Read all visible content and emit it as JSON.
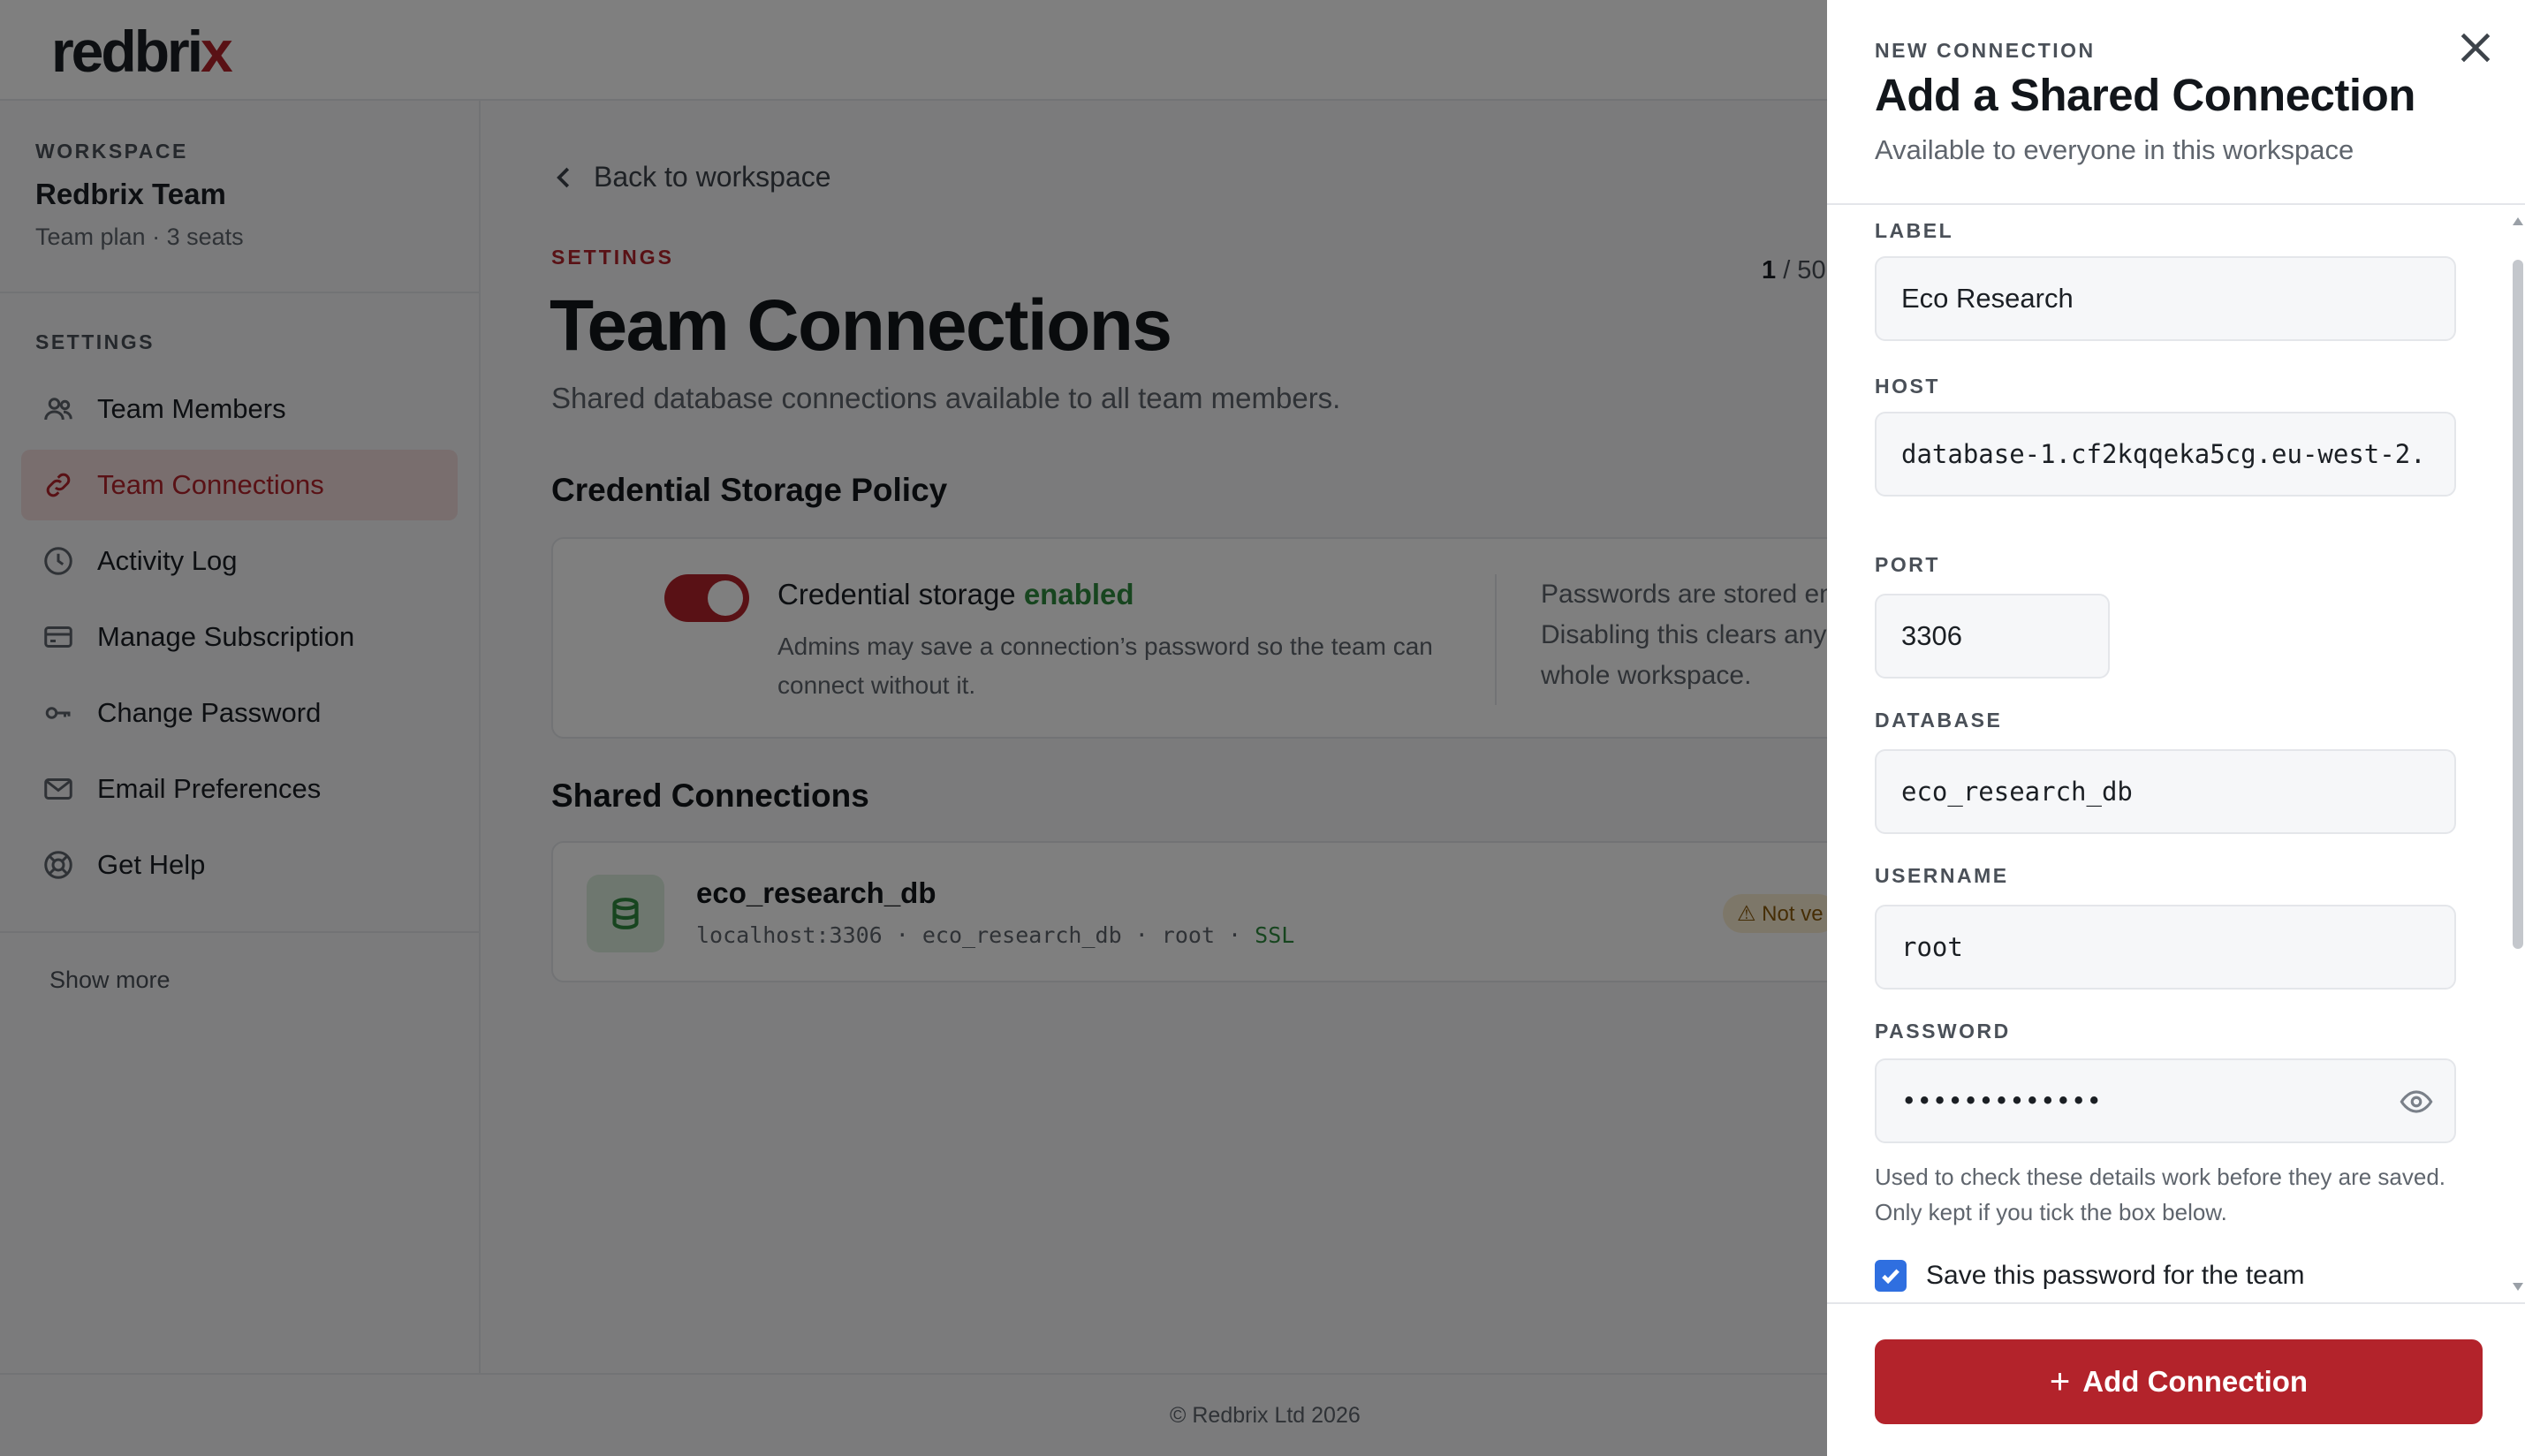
{
  "app": {
    "logo_main": "redbri",
    "logo_accent": "x"
  },
  "sidebar": {
    "workspace_eyebrow": "WORKSPACE",
    "workspace_name": "Redbrix Team",
    "workspace_plan": "Team plan · 3 seats",
    "settings_eyebrow": "SETTINGS",
    "items": [
      {
        "label": "Team Members",
        "icon": "users-icon"
      },
      {
        "label": "Team Connections",
        "icon": "link-icon",
        "active": true
      },
      {
        "label": "Activity Log",
        "icon": "clock-icon"
      },
      {
        "label": "Manage Subscription",
        "icon": "credit-card-icon"
      },
      {
        "label": "Change Password",
        "icon": "key-icon"
      },
      {
        "label": "Email Preferences",
        "icon": "mail-icon"
      },
      {
        "label": "Get Help",
        "icon": "lifebuoy-icon"
      }
    ],
    "show_more": "Show more"
  },
  "main": {
    "back_label": "Back to workspace",
    "settings_label": "SETTINGS",
    "counter_current": "1",
    "counter_rest": " / 50",
    "title": "Team Connections",
    "subtitle": "Shared database connections available to all team members.",
    "policy_title": "Credential Storage Policy",
    "policy": {
      "toggle_on": true,
      "status_prefix": "Credential storage ",
      "status_value": "enabled",
      "description": "Admins may save a connection’s password so the team can connect without it.",
      "note": "Passwords are stored en Disabling this clears any whole workspace.",
      "note_lines": [
        "Passwords are stored en",
        "Disabling this clears any",
        "whole workspace."
      ]
    },
    "connections_title": "Shared Connections",
    "connections": [
      {
        "name": "eco_research_db",
        "meta": "localhost:3306 · eco_research_db · root · ",
        "ssl": "SSL",
        "badge": "⚠ Not ve",
        "icon": "database-icon"
      }
    ]
  },
  "footer": {
    "copyright": "© Redbrix Ltd 2026"
  },
  "drawer": {
    "eyebrow": "NEW CONNECTION",
    "title": "Add a Shared Connection",
    "subtitle": "Available to everyone in this workspace",
    "fields": {
      "label": {
        "label": "LABEL",
        "value": "Eco Research"
      },
      "host": {
        "label": "HOST",
        "value": "database-1.cf2kqqeka5cg.eu-west-2."
      },
      "port": {
        "label": "PORT",
        "value": "3306"
      },
      "database": {
        "label": "DATABASE",
        "value": "eco_research_db"
      },
      "username": {
        "label": "USERNAME",
        "value": "root"
      },
      "password": {
        "label": "PASSWORD",
        "value": "•••••••••••••"
      }
    },
    "help_text": "Used to check these details work before they are saved. Only kept if you tick the box below.",
    "save_checkbox": {
      "label": "Save this password for the team",
      "checked": true
    },
    "submit_label": "Add Connection"
  },
  "colors": {
    "brand": "#b3232b",
    "success": "#2e8b3e",
    "checkbox": "#2f6fe0"
  }
}
